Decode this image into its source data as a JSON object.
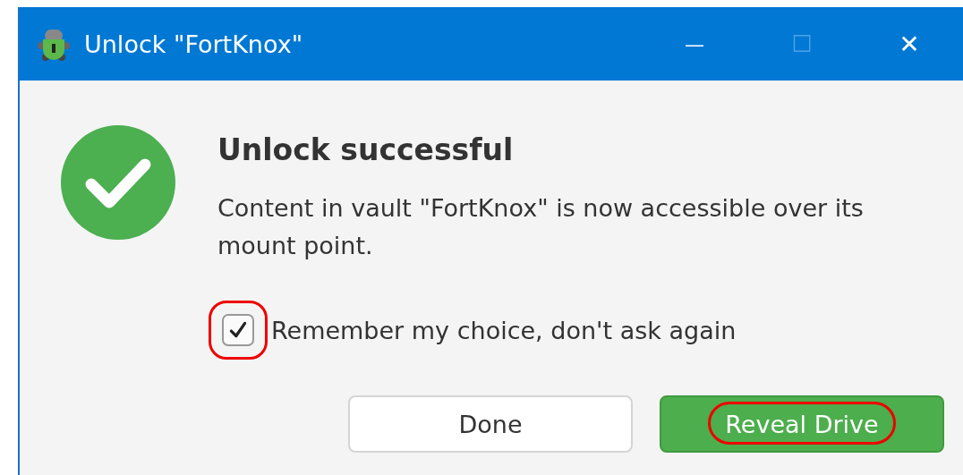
{
  "window": {
    "title": "Unlock \"FortKnox\"",
    "controls": [
      {
        "kind": "minimize",
        "glyph": "—",
        "disabled": false
      },
      {
        "kind": "maximize",
        "glyph": "☐",
        "disabled": true
      },
      {
        "kind": "close",
        "glyph": "✕",
        "disabled": false
      }
    ]
  },
  "heading": "Unlock successful",
  "message": "Content in vault \"FortKnox\" is now accessible over its mount point.",
  "checkbox": {
    "label": "Remember my choice, don't ask again",
    "checked": true,
    "highlighted": true
  },
  "buttons": [
    {
      "label": "Done",
      "kind": "secondary",
      "highlighted": false
    },
    {
      "label": "Reveal Drive",
      "kind": "primary",
      "highlighted": true
    }
  ]
}
